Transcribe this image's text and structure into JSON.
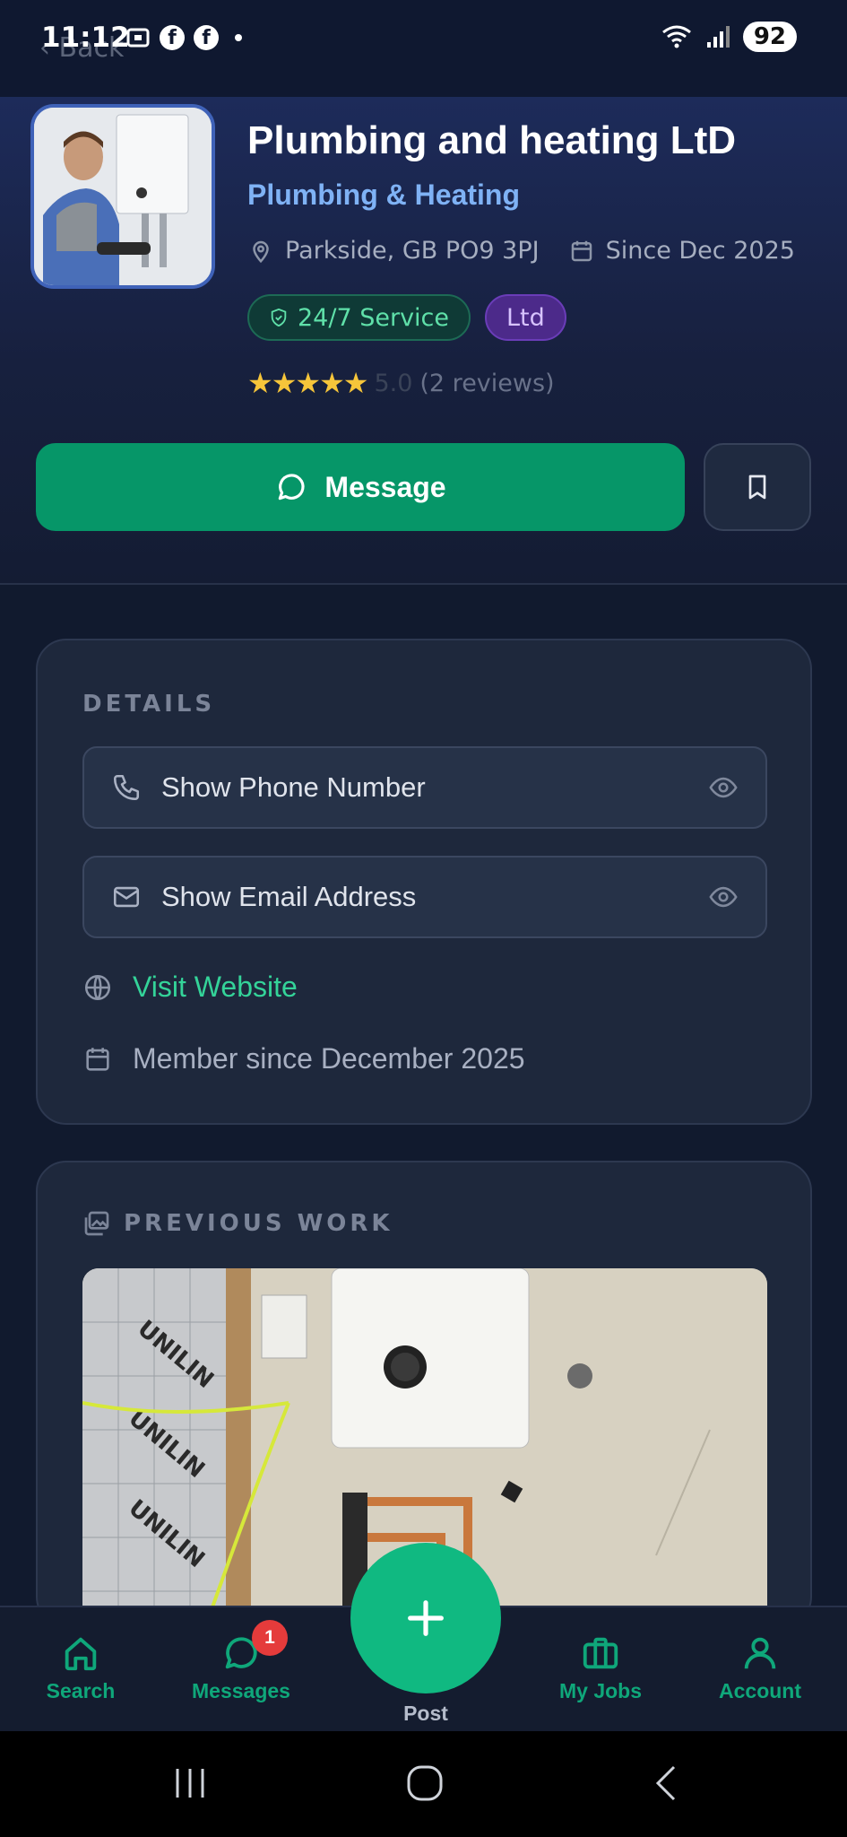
{
  "status": {
    "time": "11:12",
    "battery": "92"
  },
  "nav": {
    "back_label": "Back"
  },
  "profile": {
    "name": "Plumbing and heating LtD",
    "category": "Plumbing & Heating",
    "location": "Parkside, GB PO9 3PJ",
    "since": "Since Dec 2025",
    "badge_service": "24/7 Service",
    "badge_type": "Ltd",
    "rating_stars": 5,
    "rating_score": "5.0",
    "review_count": "(2 reviews)"
  },
  "actions": {
    "message_label": "Message",
    "save_icon": "bookmark-icon"
  },
  "details": {
    "title": "DETAILS",
    "phone_label": "Show Phone Number",
    "email_label": "Show Email Address",
    "website_label": "Visit Website",
    "member_since": "Member since December 2025"
  },
  "previous_work": {
    "title": "PREVIOUS WORK"
  },
  "bottom_nav": {
    "items": [
      {
        "label": "Search",
        "icon": "home-icon"
      },
      {
        "label": "Messages",
        "icon": "chat-icon",
        "badge": "1"
      },
      {
        "label": "Post",
        "icon": "plus-icon"
      },
      {
        "label": "My Jobs",
        "icon": "briefcase-icon"
      },
      {
        "label": "Account",
        "icon": "user-icon"
      }
    ]
  },
  "colors": {
    "accent": "#069668",
    "link": "#34d399",
    "category": "#7fb2f5",
    "badge_red": "#e53b3b"
  }
}
